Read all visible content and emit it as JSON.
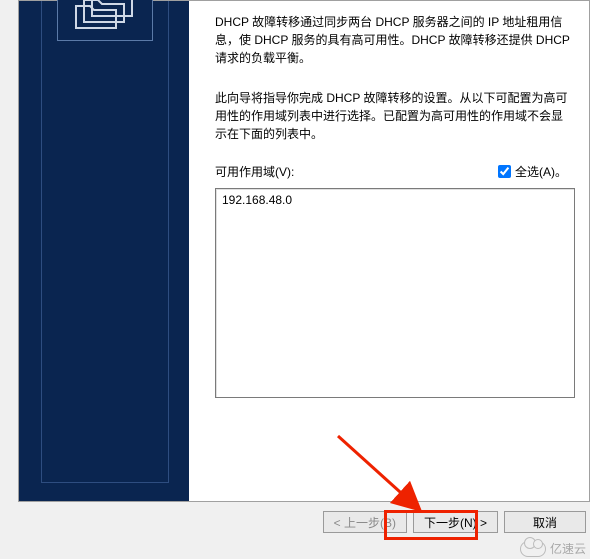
{
  "description": {
    "p1": "DHCP 故障转移通过同步两台 DHCP 服务器之间的 IP 地址租用信息，使 DHCP 服务的具有高可用性。DHCP 故障转移还提供 DHCP 请求的负载平衡。",
    "p2": "此向导将指导你完成 DHCP 故障转移的设置。从以下可配置为高可用性的作用域列表中进行选择。已配置为高可用性的作用域不会显示在下面的列表中。"
  },
  "scope": {
    "label": "可用作用域(V):",
    "selectAllLabel": "全选(A)。",
    "selectAllChecked": true,
    "items": [
      "192.168.48.0"
    ]
  },
  "buttons": {
    "back": "< 上一步(B)",
    "next": "下一步(N) >",
    "cancel": "取消"
  },
  "watermark": "亿速云"
}
